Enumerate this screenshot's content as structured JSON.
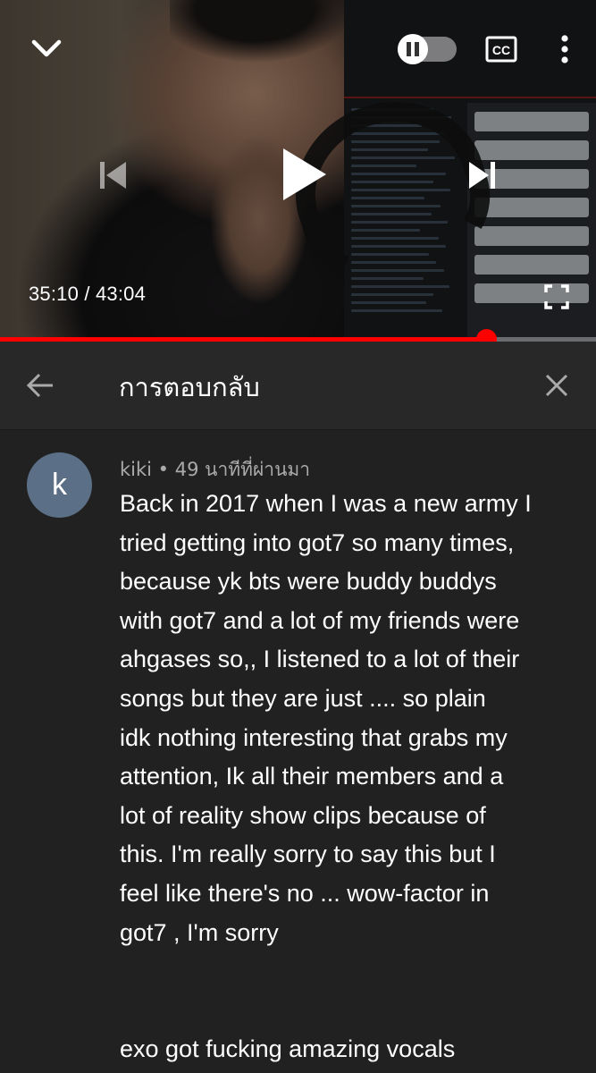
{
  "player": {
    "time_current": "35:10",
    "time_total": "43:04",
    "time_separator": " / ",
    "progress": 0.815,
    "icons": {
      "collapse": "chevron-down-icon",
      "autoplay": "pause-toggle-icon",
      "captions": "closed-captions-icon",
      "more": "more-vert-icon",
      "previous": "skip-previous-icon",
      "play": "play-icon",
      "next": "skip-next-icon",
      "fullscreen": "fullscreen-icon"
    },
    "accent_color": "#ff0000"
  },
  "replies_header": {
    "title": "การตอบกลับ",
    "back_icon": "arrow-back-icon",
    "close_icon": "close-icon"
  },
  "comment": {
    "avatar_letter": "k",
    "avatar_color": "#5b7086",
    "author": "kiki",
    "separator": " • ",
    "time_ago": "49 นาทีที่ผ่านมา",
    "lines": [
      "Back in 2017 when I was a new army I",
      "tried getting into got7 so many times,",
      "because yk bts were buddy buddys",
      "with got7 and a lot of my friends were",
      "ahgases so,, I listened to a lot of their",
      "songs but they are just .... so plain",
      "idk nothing interesting that grabs my",
      "attention, Ik all their members and a",
      "lot of reality show clips because of",
      "this. I'm really sorry to say this but I",
      "feel like there's no ... wow-factor in",
      "got7 , I'm sorry"
    ],
    "lines_after_gap": [
      "exo got fucking amazing vocals"
    ]
  }
}
